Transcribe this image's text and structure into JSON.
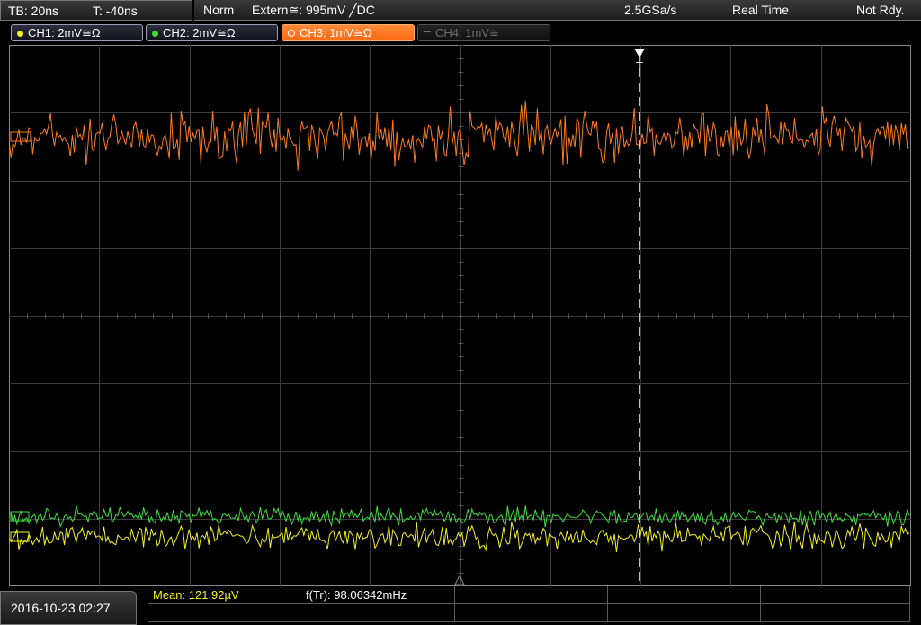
{
  "timebase": {
    "tb": "TB: 20ns",
    "t": "T: -40ns"
  },
  "status": {
    "mode": "Norm",
    "trigger": "Extern≅: 995mV ╱DC",
    "sample_rate": "2.5GSa/s",
    "acq_mode": "Real Time",
    "state": "Not Rdy."
  },
  "channels": [
    {
      "label": "CH1: 2mV≅Ω",
      "color": "#f5f020",
      "state": "on"
    },
    {
      "label": "CH2: 2mV≅Ω",
      "color": "#3ee03e",
      "state": "on"
    },
    {
      "label": "CH3: 1mV≅Ω",
      "color": "#ff7a1e",
      "state": "active"
    },
    {
      "label": "CH4: 1mV≅",
      "color": "#6d6d6d",
      "state": "off"
    }
  ],
  "trigger_marker": "T",
  "measurements": {
    "mean": "Mean: 121.92µV",
    "freq": "f(Tr): 98.06342mHz"
  },
  "datetime": "2016-10-23 02:27",
  "colors": {
    "ch1": "#f5f020",
    "ch2": "#3ee03e",
    "ch3": "#ff7a1e",
    "grid": "#3c3c3c"
  }
}
